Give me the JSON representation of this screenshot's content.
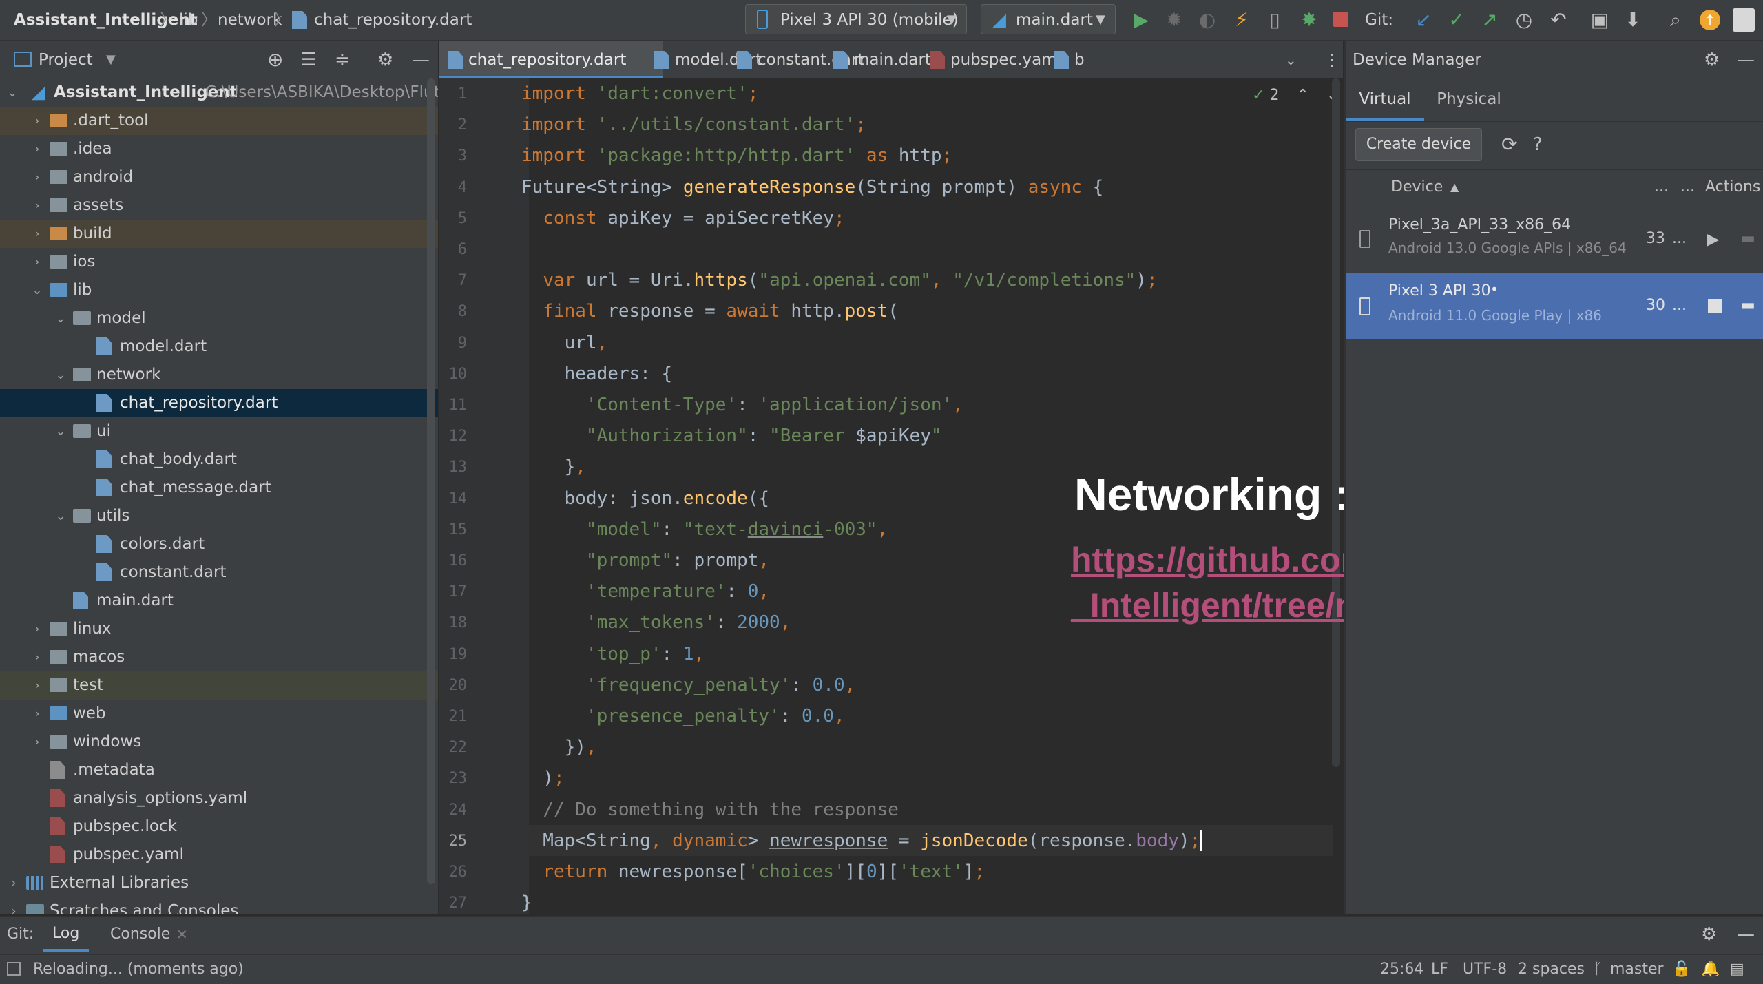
{
  "breadcrumb": {
    "project": "Assistant_Intelligent",
    "items": [
      "lib",
      "network",
      "chat_repository.dart"
    ]
  },
  "toolbar": {
    "device_selector": "Pixel 3 API 30 (mobile)",
    "run_config": "main.dart",
    "git_label": "Git:"
  },
  "project_panel": {
    "title": "Project",
    "root_name": "Assistant_Intelligent",
    "root_path": "C:\\Users\\ASBIKA\\Desktop\\Flutter",
    "tree": [
      {
        "label": ".dart_tool",
        "depth": 1,
        "expanded": false,
        "kind": "folder-orange"
      },
      {
        "label": ".idea",
        "depth": 1,
        "expanded": false,
        "kind": "folder"
      },
      {
        "label": "android",
        "depth": 1,
        "expanded": false,
        "kind": "folder"
      },
      {
        "label": "assets",
        "depth": 1,
        "expanded": false,
        "kind": "folder"
      },
      {
        "label": "build",
        "depth": 1,
        "expanded": false,
        "kind": "folder-orange"
      },
      {
        "label": "ios",
        "depth": 1,
        "expanded": false,
        "kind": "folder"
      },
      {
        "label": "lib",
        "depth": 1,
        "expanded": true,
        "kind": "folder-blue"
      },
      {
        "label": "model",
        "depth": 2,
        "expanded": true,
        "kind": "folder"
      },
      {
        "label": "model.dart",
        "depth": 3,
        "kind": "dart"
      },
      {
        "label": "network",
        "depth": 2,
        "expanded": true,
        "kind": "folder"
      },
      {
        "label": "chat_repository.dart",
        "depth": 3,
        "kind": "dart",
        "selected": true
      },
      {
        "label": "ui",
        "depth": 2,
        "expanded": true,
        "kind": "folder"
      },
      {
        "label": "chat_body.dart",
        "depth": 3,
        "kind": "dart"
      },
      {
        "label": "chat_message.dart",
        "depth": 3,
        "kind": "dart"
      },
      {
        "label": "utils",
        "depth": 2,
        "expanded": true,
        "kind": "folder"
      },
      {
        "label": "colors.dart",
        "depth": 3,
        "kind": "dart"
      },
      {
        "label": "constant.dart",
        "depth": 3,
        "kind": "dart"
      },
      {
        "label": "main.dart",
        "depth": 2,
        "kind": "dart"
      },
      {
        "label": "linux",
        "depth": 1,
        "expanded": false,
        "kind": "folder"
      },
      {
        "label": "macos",
        "depth": 1,
        "expanded": false,
        "kind": "folder"
      },
      {
        "label": "test",
        "depth": 1,
        "expanded": false,
        "kind": "folder-green"
      },
      {
        "label": "web",
        "depth": 1,
        "expanded": false,
        "kind": "folder-blue"
      },
      {
        "label": "windows",
        "depth": 1,
        "expanded": false,
        "kind": "folder"
      },
      {
        "label": ".metadata",
        "depth": 1,
        "kind": "file"
      },
      {
        "label": "analysis_options.yaml",
        "depth": 1,
        "kind": "yaml"
      },
      {
        "label": "pubspec.lock",
        "depth": 1,
        "kind": "yaml"
      },
      {
        "label": "pubspec.yaml",
        "depth": 1,
        "kind": "yaml"
      },
      {
        "label": "External Libraries",
        "depth": 0,
        "expanded": false,
        "kind": "lib"
      },
      {
        "label": "Scratches and Consoles",
        "depth": 0,
        "expanded": false,
        "kind": "scratch"
      }
    ]
  },
  "editor_tabs": [
    {
      "label": "chat_repository.dart",
      "active": true
    },
    {
      "label": "model.dart"
    },
    {
      "label": "constant.dart"
    },
    {
      "label": "main.dart"
    },
    {
      "label": "pubspec.yaml"
    },
    {
      "label": "b"
    }
  ],
  "editor": {
    "inspection_count": "2",
    "current_line": 25
  },
  "device_manager": {
    "title": "Device Manager",
    "tabs": [
      "Virtual",
      "Physical"
    ],
    "create_button": "Create device",
    "col_device": "Device",
    "col_dots1": "...",
    "col_dots2": "...",
    "col_actions": "Actions",
    "devices": [
      {
        "name": "Pixel_3a_API_33_x86_64",
        "detail": "Android 13.0 Google APIs | x86_64",
        "api": "33",
        "more": "...",
        "running": false
      },
      {
        "name": "Pixel 3 API 30",
        "detail": "Android 11.0 Google Play | x86",
        "api": "30",
        "more": "...",
        "running": true
      }
    ]
  },
  "bottom_tools": {
    "git": "Git:",
    "log": "Log",
    "console": "Console"
  },
  "status": {
    "message": "Reloading... (moments ago)",
    "position": "25:64",
    "line_ending": "LF",
    "encoding": "UTF-8",
    "indent": "2 spaces",
    "branch": "master"
  },
  "overlay": {
    "title": "Networking :",
    "link_line1": "https://github.com/Asbika/Assistant",
    "link_line2": "_Intelligent/tree/master/lib/network"
  },
  "colors": {
    "keyword": "#cc7832",
    "string": "#6a8759",
    "number": "#6897bb",
    "function": "#ffc66d",
    "link": "#b34f7a",
    "selection": "#0d293e",
    "device_selected": "#4b6eaf"
  }
}
